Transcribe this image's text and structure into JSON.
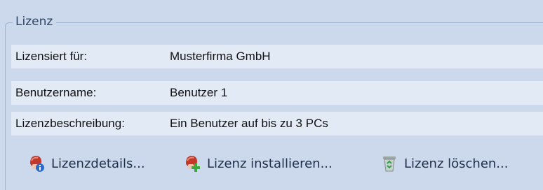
{
  "group": {
    "title": "Lizenz"
  },
  "info": {
    "rows": [
      {
        "label": "Lizensiert für:",
        "value": "Musterfirma GmbH"
      },
      {
        "label": "Benutzername:",
        "value": "Benutzer 1"
      },
      {
        "label": "Lizenzbeschreibung:",
        "value": "Ein Benutzer auf bis zu 3 PCs"
      }
    ]
  },
  "toolbar": {
    "details_label": "Lizenzdetails...",
    "install_label": "Lizenz installieren...",
    "delete_label": "Lizenz löschen..."
  },
  "icons": {
    "details": "license-info-icon",
    "install": "license-install-icon",
    "delete": "recycle-bin-icon"
  },
  "colors": {
    "background": "#ccd9ec",
    "row_background": "#e2eaf5",
    "frame": "#9fb4d0",
    "title_text": "#30466b",
    "text": "#111111"
  }
}
